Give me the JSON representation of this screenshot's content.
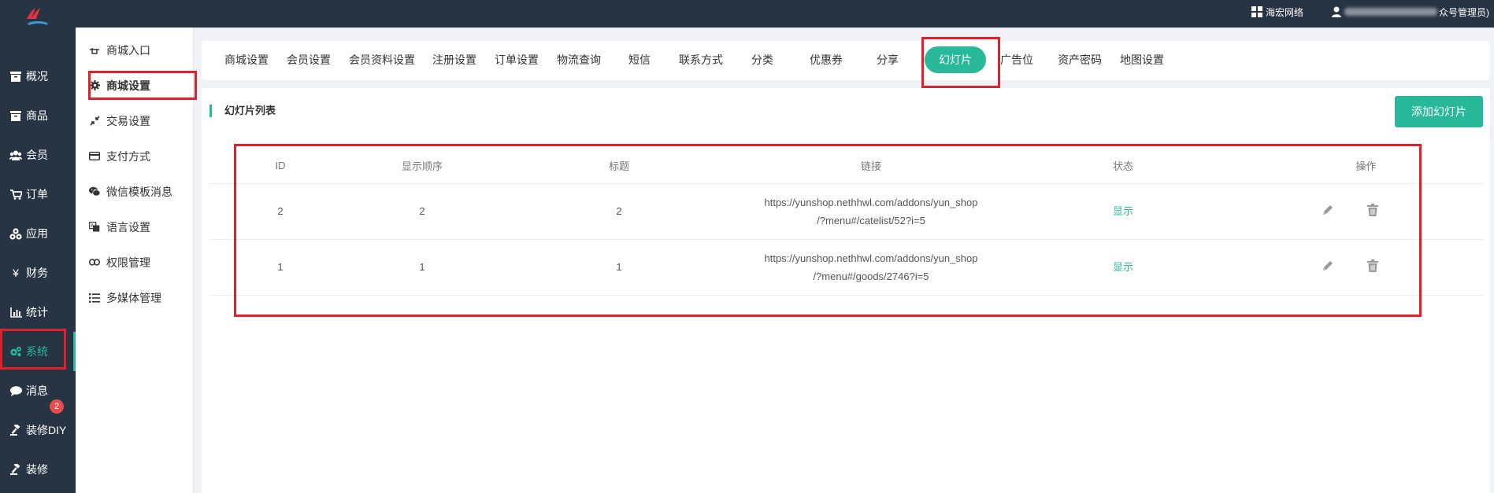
{
  "topbar": {
    "org_label": "海宏网络",
    "admin_label": "众号管理员)"
  },
  "leftnav": {
    "items": [
      {
        "label": "概况",
        "icon": "dashboard-icon"
      },
      {
        "label": "商品",
        "icon": "box-icon"
      },
      {
        "label": "会员",
        "icon": "users-icon"
      },
      {
        "label": "订单",
        "icon": "cart-icon"
      },
      {
        "label": "应用",
        "icon": "apps-icon"
      },
      {
        "label": "财务",
        "icon": "yen-icon"
      },
      {
        "label": "统计",
        "icon": "bar-chart-icon"
      },
      {
        "label": "系统",
        "icon": "gears-icon"
      },
      {
        "label": "消息",
        "icon": "comment-icon"
      },
      {
        "label": "装修DIY",
        "icon": "gavel-icon"
      },
      {
        "label": "装修",
        "icon": "gavel-icon"
      }
    ],
    "message_badge": "2"
  },
  "subnav": {
    "items": [
      {
        "label": "商城入口",
        "icon": "hand-point-icon"
      },
      {
        "label": "商城设置",
        "icon": "gear-icon"
      },
      {
        "label": "交易设置",
        "icon": "compress-arrows-icon"
      },
      {
        "label": "支付方式",
        "icon": "credit-card-icon"
      },
      {
        "label": "微信模板消息",
        "icon": "wechat-icon"
      },
      {
        "label": "语言设置",
        "icon": "language-icon"
      },
      {
        "label": "权限管理",
        "icon": "link-icon"
      },
      {
        "label": "多媒体管理",
        "icon": "list-icon"
      }
    ]
  },
  "tabs": [
    "商城设置",
    "会员设置",
    "会员资料设置",
    "注册设置",
    "订单设置",
    "物流查询",
    "短信",
    "联系方式",
    "分类",
    "优惠券",
    "分享",
    "幻灯片",
    "广告位",
    "资产密码",
    "地图设置"
  ],
  "panel": {
    "title": "幻灯片列表",
    "add_button": "添加幻灯片"
  },
  "table": {
    "headers": [
      "ID",
      "显示顺序",
      "标题",
      "链接",
      "状态",
      "操作"
    ],
    "rows": [
      {
        "id": "2",
        "order": "2",
        "title": "2",
        "link_line1": "https://yunshop.nethhwl.com/addons/yun_shop",
        "link_line2": "/?menu#/catelist/52?i=5",
        "status": "显示"
      },
      {
        "id": "1",
        "order": "1",
        "title": "1",
        "link_line1": "https://yunshop.nethhwl.com/addons/yun_shop",
        "link_line2": "/?menu#/goods/2746?i=5",
        "status": "显示"
      }
    ]
  },
  "colors": {
    "accent": "#27b99a",
    "sidebar_bg": "#273443",
    "annotation_red": "#e0202a",
    "badge_red": "#e84c4c"
  }
}
